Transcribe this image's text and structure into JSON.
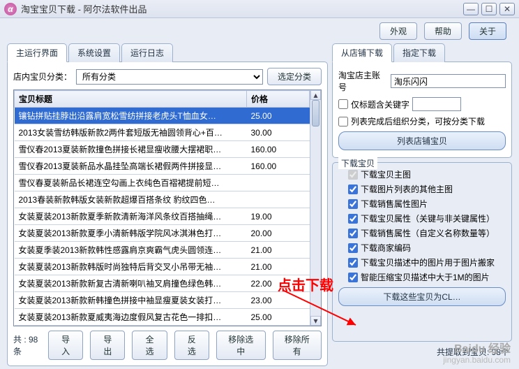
{
  "window": {
    "title": "淘宝宝贝下载 - 阿尔法软件出品"
  },
  "topbar": {
    "appearance": "外观",
    "help": "帮助",
    "about": "关于"
  },
  "left_tabs": {
    "t1": "主运行界面",
    "t2": "系统设置",
    "t3": "运行日志"
  },
  "category": {
    "label": "店内宝贝分类：",
    "selected": "所有分类",
    "select_btn": "选定分类"
  },
  "table": {
    "col_title": "宝贝标题",
    "col_price": "价格",
    "rows": [
      {
        "title": "镶钻拼贴挂脖出沿露肩宽松雪纺拼接老虎头T恤血女…",
        "price": "25.00",
        "selected": true
      },
      {
        "title": "2013女装雪纺韩版新款2两件套短版无袖圆领背心+百…",
        "price": "30.00"
      },
      {
        "title": "雪仪春2013夏装新款撞色拼接长裙显瘦收腰大摆裙职…",
        "price": "160.00"
      },
      {
        "title": "雪仪春2013夏装新品水晶挂坠高端长裙假两件拼接显…",
        "price": "160.00"
      },
      {
        "title": "雪仪春夏装新品长裙连空勾画上衣纯色百褶裙提前短…",
        "price": ""
      },
      {
        "title": "2013春装新款韩版女装新款超爆百搭条纹 豹纹四色…",
        "price": ""
      },
      {
        "title": "女装夏装2013新款夏季新款清新海洋风条纹百搭抽绳…",
        "price": "19.00"
      },
      {
        "title": "女装夏装2013新款夏季小清新韩版学院风冰淇淋色打…",
        "price": "20.00"
      },
      {
        "title": "女装夏季装2013新款韩性感露肩京爽霸气虎头圆领连…",
        "price": "21.00"
      },
      {
        "title": "女装夏装2013新款韩版时尚独特后背交叉小吊带无袖…",
        "price": "21.00"
      },
      {
        "title": "女装夏装2013新款新复古清新喇叭袖叉肩撞色绿色韩…",
        "price": "22.00"
      },
      {
        "title": "女装夏装2013新款新韩撞色拼接中袖显瘦夏装女装打…",
        "price": "23.00"
      },
      {
        "title": "女装夏装2013新款夏威夷海边度假风复古花色一排扣…",
        "price": "25.00"
      }
    ],
    "count": "共 : 98条"
  },
  "left_btns": {
    "import": "导入",
    "export": "导出",
    "selall": "全选",
    "invert": "反选",
    "rmsel": "移除选中",
    "rmall": "移除所有"
  },
  "right_tabs": {
    "t1": "从店铺下载",
    "t2": "指定下载"
  },
  "shop": {
    "acct_label": "淘宝店主账号",
    "acct_val": "淘乐闪闪",
    "only_title": "仅标题含关键字",
    "list_done": "列表完成后组织分类，可按分类下载",
    "list_btn": "列表店铺宝贝"
  },
  "dl": {
    "legend": "下载宝贝",
    "o1": "下载宝贝主图",
    "o2": "下载图片列表的其他主图",
    "o3": "下载销售属性图片",
    "o4": "下载宝贝属性（关键与非关键属性）",
    "o5": "下载销售属性（自定义名称数量等）",
    "o6": "下载商家编码",
    "o7": "下载宝贝描述中的图片用于图片搬家",
    "o8": "智能压缩宝贝描述中大于1M的图片",
    "btn": "下载这些宝贝为CL…"
  },
  "right_footer": "共提取到宝贝: 98个",
  "annot": "点击下载",
  "watermark": {
    "l1": "Baidu 经验",
    "l2": "jingyan.baidu.com"
  }
}
